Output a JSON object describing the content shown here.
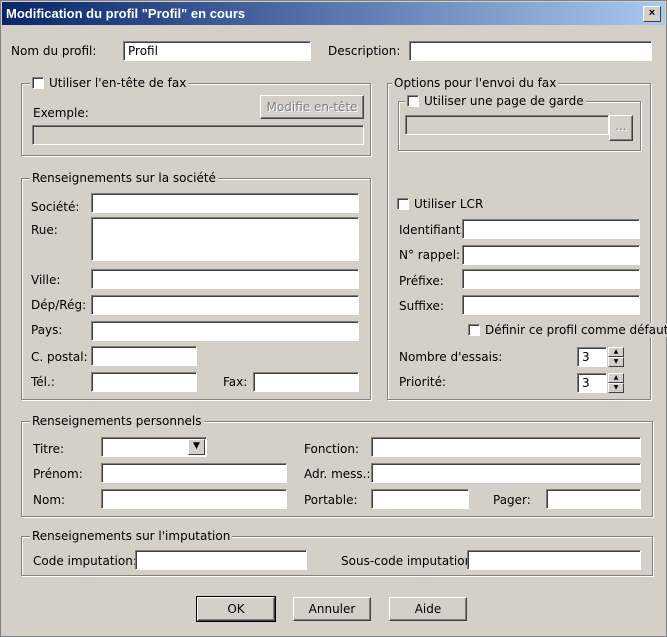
{
  "title": "Modification du profil \"Profil\" en cours",
  "close": "×",
  "profile": {
    "name_label": "Nom du profil:",
    "name_value": "Profil",
    "desc_label": "Description:",
    "desc_value": ""
  },
  "header_group": {
    "checkbox": "Utiliser l'en-tête de fax",
    "example_label": "Exemple:",
    "modify_button": "Modifie en-tête",
    "example_value": ""
  },
  "company": {
    "title": "Renseignements sur la société",
    "societe": "Société:",
    "rue": "Rue:",
    "ville": "Ville:",
    "dep": "Dép/Rég:",
    "pays": "Pays:",
    "cpostal": "C. postal:",
    "tel": "Tél.:",
    "fax": "Fax:"
  },
  "options": {
    "title": "Options pour l'envoi du fax",
    "cover_checkbox": "Utiliser une page de garde",
    "browse": "...",
    "lcr_checkbox": "Utiliser LCR",
    "identifiant": "Identifiant:",
    "rappel": "N° rappel:",
    "prefixe": "Préfixe:",
    "suffixe": "Suffixe:",
    "default_checkbox": "Définir ce profil comme défaut",
    "tries_label": "Nombre d'essais:",
    "tries_value": "3",
    "priority_label": "Priorité:",
    "priority_value": "3"
  },
  "personal": {
    "title": "Renseignements personnels",
    "titre": "Titre:",
    "prenom": "Prénom:",
    "nom": "Nom:",
    "fonction": "Fonction:",
    "adr": "Adr. mess.:",
    "portable": "Portable:",
    "pager": "Pager:"
  },
  "imputation": {
    "title": "Renseignements sur l'imputation",
    "code": "Code imputation:",
    "souscode": "Sous-code imputation:"
  },
  "buttons": {
    "ok": "OK",
    "cancel": "Annuler",
    "help": "Aide"
  }
}
